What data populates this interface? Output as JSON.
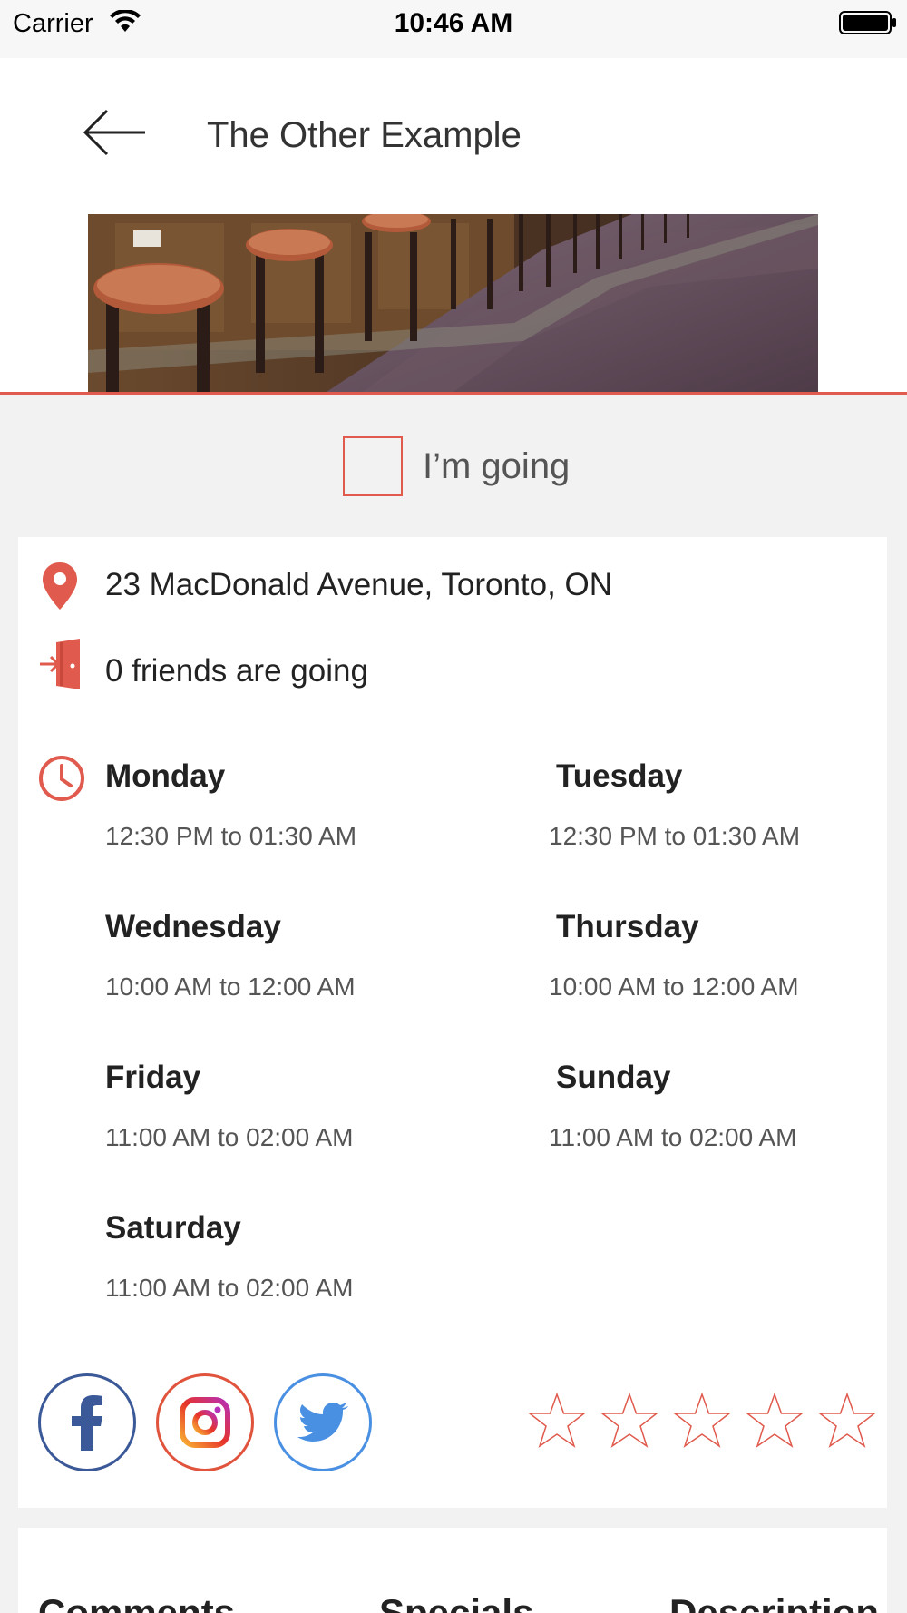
{
  "status_bar": {
    "carrier": "Carrier",
    "time": "10:46 AM"
  },
  "header": {
    "title": "The Other Example",
    "back_icon": "arrow-left-icon"
  },
  "going": {
    "label": "I’m going",
    "checked": false
  },
  "info": {
    "address": "23 MacDonald Avenue, Toronto, ON",
    "friends": "0 friends are going",
    "hours": [
      {
        "day": "Monday",
        "time": "12:30 PM to 01:30 AM"
      },
      {
        "day": "Tuesday",
        "time": "12:30 PM to 01:30 AM"
      },
      {
        "day": "Wednesday",
        "time": "10:00 AM to 12:00 AM"
      },
      {
        "day": "Thursday",
        "time": "10:00 AM to 12:00 AM"
      },
      {
        "day": "Friday",
        "time": "11:00 AM to 02:00 AM"
      },
      {
        "day": "Sunday",
        "time": "11:00 AM to 02:00 AM"
      },
      {
        "day": "Saturday",
        "time": "11:00 AM to 02:00 AM"
      }
    ]
  },
  "social": [
    "facebook-icon",
    "instagram-icon",
    "twitter-icon"
  ],
  "rating": {
    "value": 0,
    "max": 5
  },
  "tabs": [
    "Comments",
    "Specials",
    "Description"
  ],
  "colors": {
    "accent": "#e05a4d",
    "facebook": "#3b5998",
    "twitter": "#4a90e2"
  }
}
